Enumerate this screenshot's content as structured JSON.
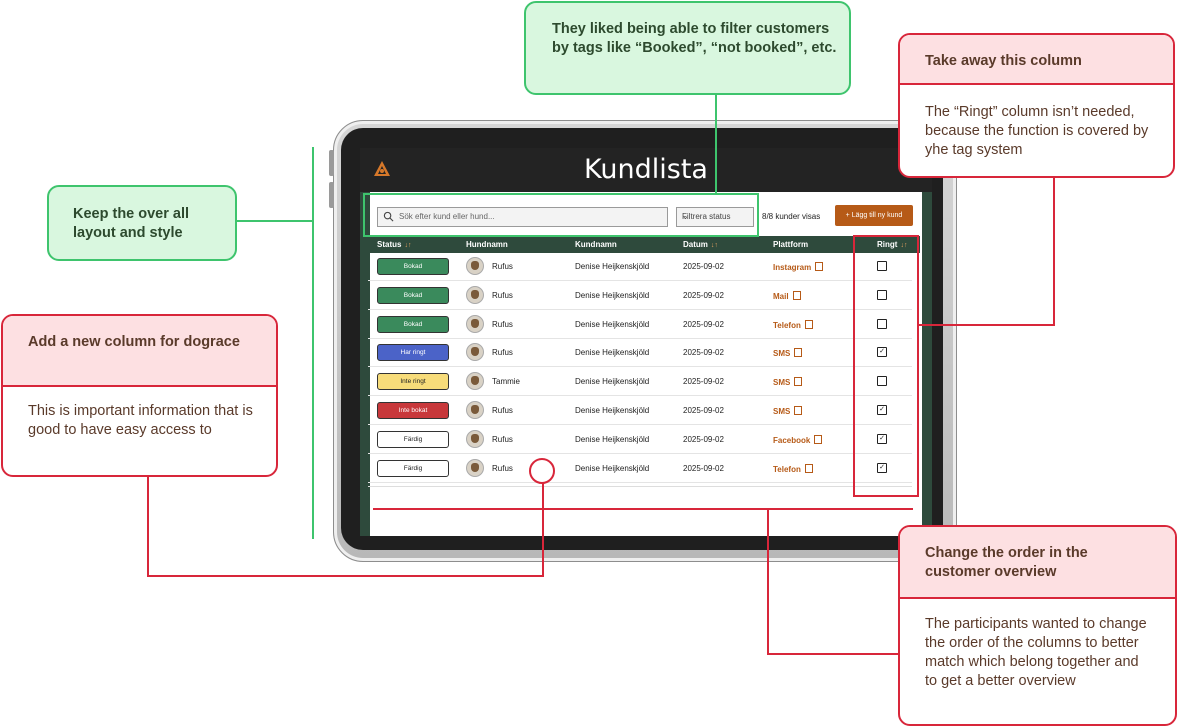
{
  "app": {
    "title": "Kundlista",
    "logo_icon": "dog-logo-icon"
  },
  "toolbar": {
    "search_placeholder": "Sök efter kund eller hund...",
    "filter_label": "Filtrera status",
    "count_text": "8/8 kunder visas",
    "add_button_label": "Lägg till ny kund",
    "add_button_icon": "+"
  },
  "table": {
    "columns": [
      {
        "label": "Status",
        "sortable": true
      },
      {
        "label": "Hundnamn",
        "sortable": false
      },
      {
        "label": "Kundnamn",
        "sortable": false
      },
      {
        "label": "Datum",
        "sortable": true
      },
      {
        "label": "Plattform",
        "sortable": false
      },
      {
        "label": "Ringt",
        "sortable": true
      }
    ],
    "sort_icon": "↓↑",
    "rows": [
      {
        "status": "Bokad",
        "dog": "Rufus",
        "customer": "Denise Heijkenskjöld",
        "date": "2025-09-02",
        "platform": "Instagram",
        "called": false
      },
      {
        "status": "Bokad",
        "dog": "Rufus",
        "customer": "Denise Heijkenskjöld",
        "date": "2025-09-02",
        "platform": "Mail",
        "called": false
      },
      {
        "status": "Bokad",
        "dog": "Rufus",
        "customer": "Denise Heijkenskjöld",
        "date": "2025-09-02",
        "platform": "Telefon",
        "called": false
      },
      {
        "status": "Har ringt",
        "dog": "Rufus",
        "customer": "Denise Heijkenskjöld",
        "date": "2025-09-02",
        "platform": "SMS",
        "called": true
      },
      {
        "status": "Inte ringt",
        "dog": "Tammie",
        "customer": "Denise Heijkenskjöld",
        "date": "2025-09-02",
        "platform": "SMS",
        "called": false
      },
      {
        "status": "Inte bokat",
        "dog": "Rufus",
        "customer": "Denise Heijkenskjöld",
        "date": "2025-09-02",
        "platform": "SMS",
        "called": true
      },
      {
        "status": "Färdig",
        "dog": "Rufus",
        "customer": "Denise Heijkenskjöld",
        "date": "2025-09-02",
        "platform": "Facebook",
        "called": true
      },
      {
        "status": "Färdig",
        "dog": "Rufus",
        "customer": "Denise Heijkenskjöld",
        "date": "2025-09-02",
        "platform": "Telefon",
        "called": true
      }
    ]
  },
  "status_colors": {
    "Bokad": {
      "bg": "#3a8a5c",
      "fg": "#ffffff"
    },
    "Har ringt": {
      "bg": "#4b63c8",
      "fg": "#ffffff"
    },
    "Inte ringt": {
      "bg": "#f7dc7a",
      "fg": "#222222"
    },
    "Inte bokat": {
      "bg": "#c8383b",
      "fg": "#ffffff"
    },
    "Färdig": {
      "bg": "#ffffff",
      "fg": "#222222"
    }
  },
  "colors": {
    "header_dark": "#232323",
    "table_header_green": "#2e4a3c",
    "accent_orange": "#b65a17",
    "annotation_green": "#3ec46d",
    "annotation_red": "#d8263a"
  },
  "annotations": {
    "filter_tags": {
      "text": "They liked being able to filter customers by tags like “Booked”, “not booked”, etc."
    },
    "keep_layout": {
      "text": "Keep the over all layout and style"
    },
    "remove_column": {
      "title": "Take away this column",
      "body": "The “Ringt” column isn’t needed, because the function is covered by yhe tag system"
    },
    "new_column": {
      "title": "Add a new column for dograce",
      "body": "This is important information that is good to have easy access to"
    },
    "change_order": {
      "title": "Change the order in the customer overview",
      "body": "The participants wanted to change the order of the columns to better match which belong together and to get a better overview"
    }
  }
}
